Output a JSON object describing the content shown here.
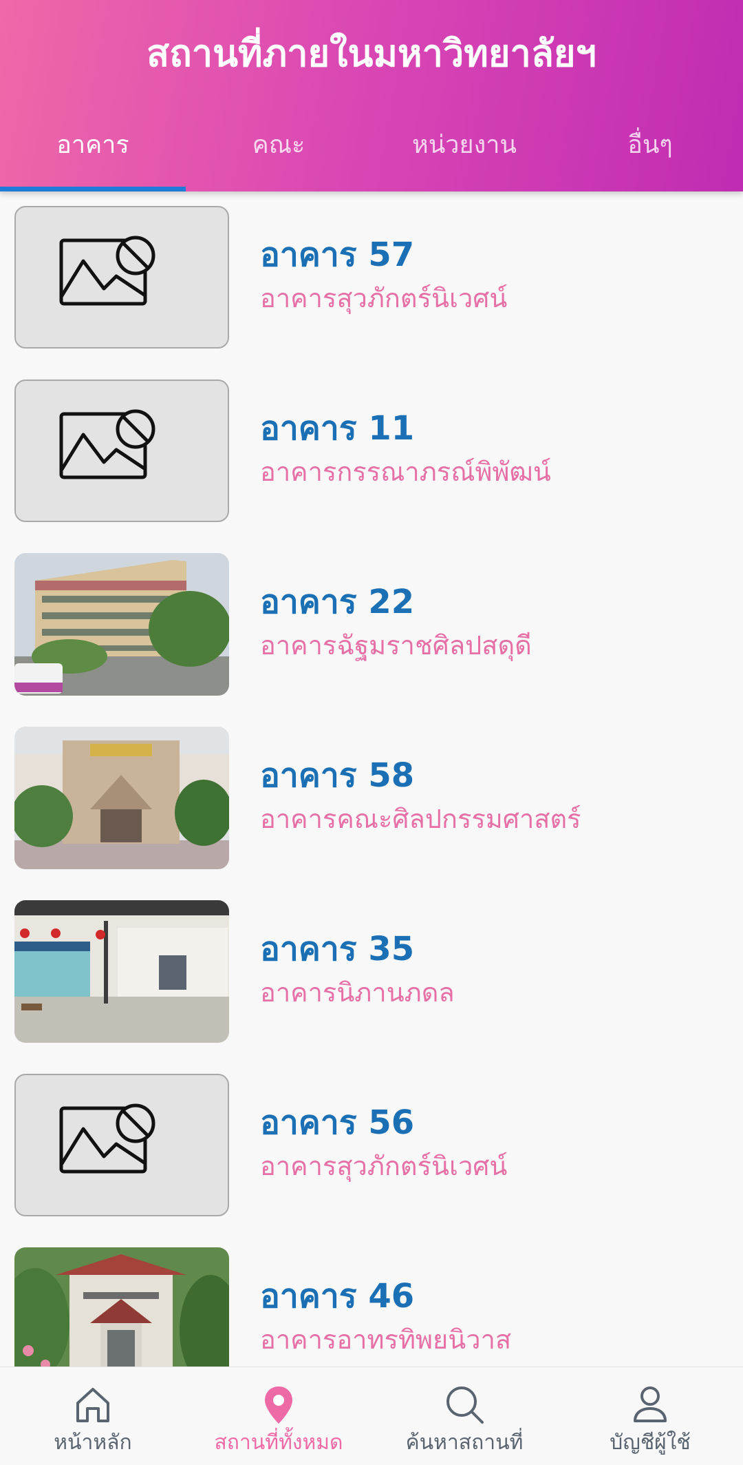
{
  "header": {
    "title": "สถานที่ภายในมหาวิทยาลัยฯ",
    "tabs": [
      {
        "label": "อาคาร",
        "active": true
      },
      {
        "label": "คณะ",
        "active": false
      },
      {
        "label": "หน่วยงาน",
        "active": false
      },
      {
        "label": "อื่นๆ",
        "active": false
      }
    ]
  },
  "buildings": [
    {
      "name": "อาคาร 57",
      "subtitle": "อาคารสุวภักตร์นิเวศน์",
      "image": "placeholder-image-icon"
    },
    {
      "name": "อาคาร 11",
      "subtitle": "อาคารกรรณาภรณ์พิพัฒน์",
      "image": "placeholder-image-icon"
    },
    {
      "name": "อาคาร 22",
      "subtitle": "อาคารฉัฐมราชศิลปสดุดี",
      "image": "photo"
    },
    {
      "name": "อาคาร 58",
      "subtitle": "อาคารคณะศิลปกรรมศาสตร์",
      "image": "photo"
    },
    {
      "name": "อาคาร 35",
      "subtitle": "อาคารนิภานภดล",
      "image": "photo"
    },
    {
      "name": "อาคาร 56",
      "subtitle": "อาคารสุวภักตร์นิเวศน์",
      "image": "placeholder-image-icon"
    },
    {
      "name": "อาคาร 46",
      "subtitle": "อาคารอาทรทิพยนิวาส",
      "image": "photo"
    }
  ],
  "bottom_nav": [
    {
      "label": "หน้าหลัก",
      "icon": "home-icon",
      "active": false
    },
    {
      "label": "สถานที่ทั้งหมด",
      "icon": "map-pin-icon",
      "active": true
    },
    {
      "label": "ค้นหาสถานที่",
      "icon": "search-icon",
      "active": false
    },
    {
      "label": "บัญชีผู้ใช้",
      "icon": "user-icon",
      "active": false
    }
  ],
  "colors": {
    "header_gradient_start": "#f068a8",
    "header_gradient_end": "#c02cb2",
    "tab_indicator": "#1e7bd8",
    "item_title": "#1b6fb4",
    "item_subtitle": "#e670a6",
    "nav_active": "#ee6aa6",
    "nav_inactive": "#5a6470"
  }
}
